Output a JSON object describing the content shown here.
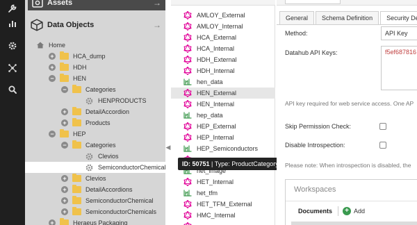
{
  "sidebar_icons": [
    "wrench-icon",
    "chart-icon",
    "gear-icon",
    "network-icon",
    "search-icon"
  ],
  "tree": {
    "assets_title": "Assets",
    "data_objects_title": "Data Objects",
    "items": [
      {
        "label": "Home",
        "toggle": "",
        "icon": "home"
      },
      {
        "label": "HCA_dump",
        "toggle": "+",
        "icon": "folder"
      },
      {
        "label": "HDH",
        "toggle": "+",
        "icon": "folder"
      },
      {
        "label": "HEN",
        "toggle": "−",
        "icon": "folder"
      },
      {
        "label": "Categories",
        "toggle": "−",
        "icon": "folder"
      },
      {
        "label": "HENPRODUCTS",
        "toggle": "",
        "icon": "gear"
      },
      {
        "label": "DetailAccordion",
        "toggle": "+",
        "icon": "folder"
      },
      {
        "label": "Products",
        "toggle": "+",
        "icon": "folder"
      },
      {
        "label": "HEP",
        "toggle": "−",
        "icon": "folder"
      },
      {
        "label": "Categories",
        "toggle": "−",
        "icon": "folder"
      },
      {
        "label": "Clevios",
        "toggle": "",
        "icon": "gear"
      },
      {
        "label": "SemiconductorChemical",
        "toggle": "",
        "icon": "gear"
      },
      {
        "label": "Clevios",
        "toggle": "+",
        "icon": "folder"
      },
      {
        "label": "DetailAccordions",
        "toggle": "+",
        "icon": "folder"
      },
      {
        "label": "SemiconductorChemical",
        "toggle": "+",
        "icon": "folder"
      },
      {
        "label": "SemiconductorChemicals",
        "toggle": "+",
        "icon": "folder"
      },
      {
        "label": "Heraeus Packaging",
        "toggle": "+",
        "icon": "folder"
      }
    ]
  },
  "class_list": [
    {
      "label": "AMLOY_External",
      "icon": "graphql"
    },
    {
      "label": "AMLOY_Internal",
      "icon": "graphql"
    },
    {
      "label": "HCA_External",
      "icon": "graphql"
    },
    {
      "label": "HCA_Internal",
      "icon": "graphql"
    },
    {
      "label": "HDH_External",
      "icon": "graphql"
    },
    {
      "label": "HDH_Internal",
      "icon": "graphql"
    },
    {
      "label": "hen_data",
      "icon": "tfm"
    },
    {
      "label": "HEN_External",
      "icon": "graphql"
    },
    {
      "label": "HEN_Internal",
      "icon": "graphql"
    },
    {
      "label": "hep_data",
      "icon": "tfm"
    },
    {
      "label": "HEP_External",
      "icon": "graphql"
    },
    {
      "label": "HEP_Internal",
      "icon": "graphql"
    },
    {
      "label": "HEP_Semiconductors",
      "icon": "tfm"
    },
    {
      "label": "",
      "icon": "graphql"
    },
    {
      "label": "het_image",
      "icon": "tfm"
    },
    {
      "label": "HET_Internal",
      "icon": "graphql"
    },
    {
      "label": "het_tfm",
      "icon": "tfm"
    },
    {
      "label": "HET_TFM_External",
      "icon": "graphql"
    },
    {
      "label": "HMC_Internal",
      "icon": "graphql"
    },
    {
      "label": "",
      "icon": "graphql"
    }
  ],
  "tooltip": {
    "id_label": "ID: 50751",
    "sep": "|",
    "type_text": "Type: ProductCategory"
  },
  "detail": {
    "tabs": [
      "General",
      "Schema Definition",
      "Security De"
    ],
    "method_label": "Method:",
    "method_value": "API Key",
    "api_keys_label": "Datahub API Keys:",
    "api_key_value": "f5ef687816",
    "api_note": "API key required for web service access. One AP",
    "skip_permission_label": "Skip Permission Check:",
    "disable_introspection_label": "Disable Introspection:",
    "introspection_note": "Please note: When introspection is disabled, the",
    "workspaces_title": "Workspaces",
    "documents_label": "Documents",
    "add_label": "Add"
  },
  "colors": {
    "rail_bg": "#1f1f1f",
    "tree_bg": "#d6d6d6",
    "graphql_pink": "#e10098",
    "tfm_green": "#3f9a4f",
    "folder": "#f0c24b",
    "add_green": "#3a9a4f"
  }
}
